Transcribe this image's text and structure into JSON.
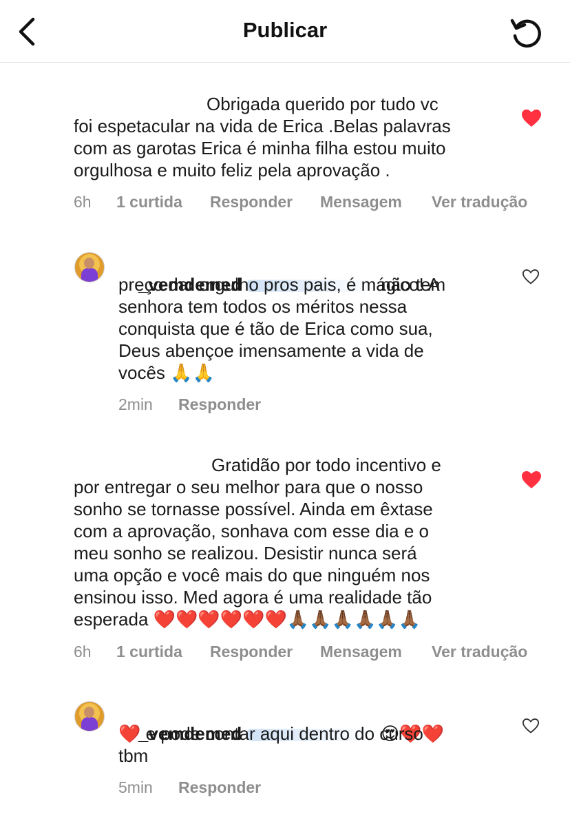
{
  "header": {
    "title": "Publicar",
    "back_icon": "chevron-left-icon",
    "refresh_icon": "refresh-icon"
  },
  "colors": {
    "like_red": "#ff3040",
    "meta_gray": "#8e8e8e"
  },
  "comments": [
    {
      "text": "Obrigada querido por tudo vc\nfoi espetacular na vida de Erica .Belas palavras\ncom as garotas Erica é minha filha estou muito\norgulhosa e muito feliz pela aprovação .",
      "time": "6h",
      "likes": "1 curtida",
      "reply": "Responder",
      "message": "Mensagem",
      "translate": "Ver tradução",
      "liked": true
    },
    {
      "username": "_vemdemed",
      "text_first": "não tem",
      "text_rest": "preço dar orgulho pros pais, é mágico! A\nsenhora tem todos os méritos nessa\nconquista que é tão de Erica como sua,\nDeus abençoe imensamente a vida de\nvocês 🙏🙏",
      "time": "2min",
      "reply": "Responder",
      "liked": false
    },
    {
      "text": "Gratidão por todo incentivo e\npor entregar o seu melhor para que o nosso\nsonho se tornasse possível. Ainda em êxtase\ncom a aprovação, sonhava com esse dia e o\nmeu sonho se realizou. Desistir nunca será\numa opção e você mais do que ninguém nos\nensinou isso. Med agora é uma realidade tão\nesperada ❤️❤️❤️❤️❤️❤️🙏🏾🙏🏾🙏🏾🙏🏾🙏🏾🙏🏾",
      "time": "6h",
      "likes": "1 curtida",
      "reply": "Responder",
      "message": "Mensagem",
      "translate": "Ver tradução",
      "liked": true
    },
    {
      "username": "_vemdemed",
      "text_first": "😍❤️❤️",
      "text_rest": "❤️ e pode contar aqui dentro do curso\ntbm",
      "time": "5min",
      "reply": "Responder",
      "liked": false
    }
  ]
}
